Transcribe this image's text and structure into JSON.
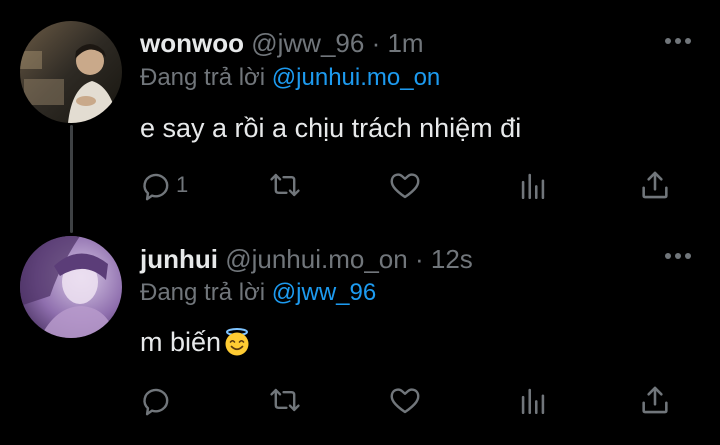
{
  "colors": {
    "background": "#000000",
    "primary_text": "#e7e9ea",
    "secondary_text": "#71767b",
    "accent": "#1d9bf0",
    "thread_line": "#3e4144"
  },
  "tweets": [
    {
      "display_name": "wonwoo",
      "handle": "@jww_96",
      "separator": "·",
      "time": "1m",
      "reply_prefix": "Đang trả lời",
      "reply_to": "@junhui.mo_on",
      "text": "e say a rồi a chịu trách nhiệm đi",
      "reply_count": "1",
      "avatar_icon": "user-photo"
    },
    {
      "display_name": "junhui",
      "handle": "@junhui.mo_on",
      "separator": "·",
      "time": "12s",
      "reply_prefix": "Đang trả lời",
      "reply_to": "@jww_96",
      "text": "m biến",
      "emoji": "smiling-face-with-halo",
      "reply_count": "",
      "avatar_icon": "user-photo"
    }
  ],
  "action_icons": [
    "reply-icon",
    "retweet-icon",
    "like-icon",
    "analytics-icon",
    "share-icon"
  ]
}
